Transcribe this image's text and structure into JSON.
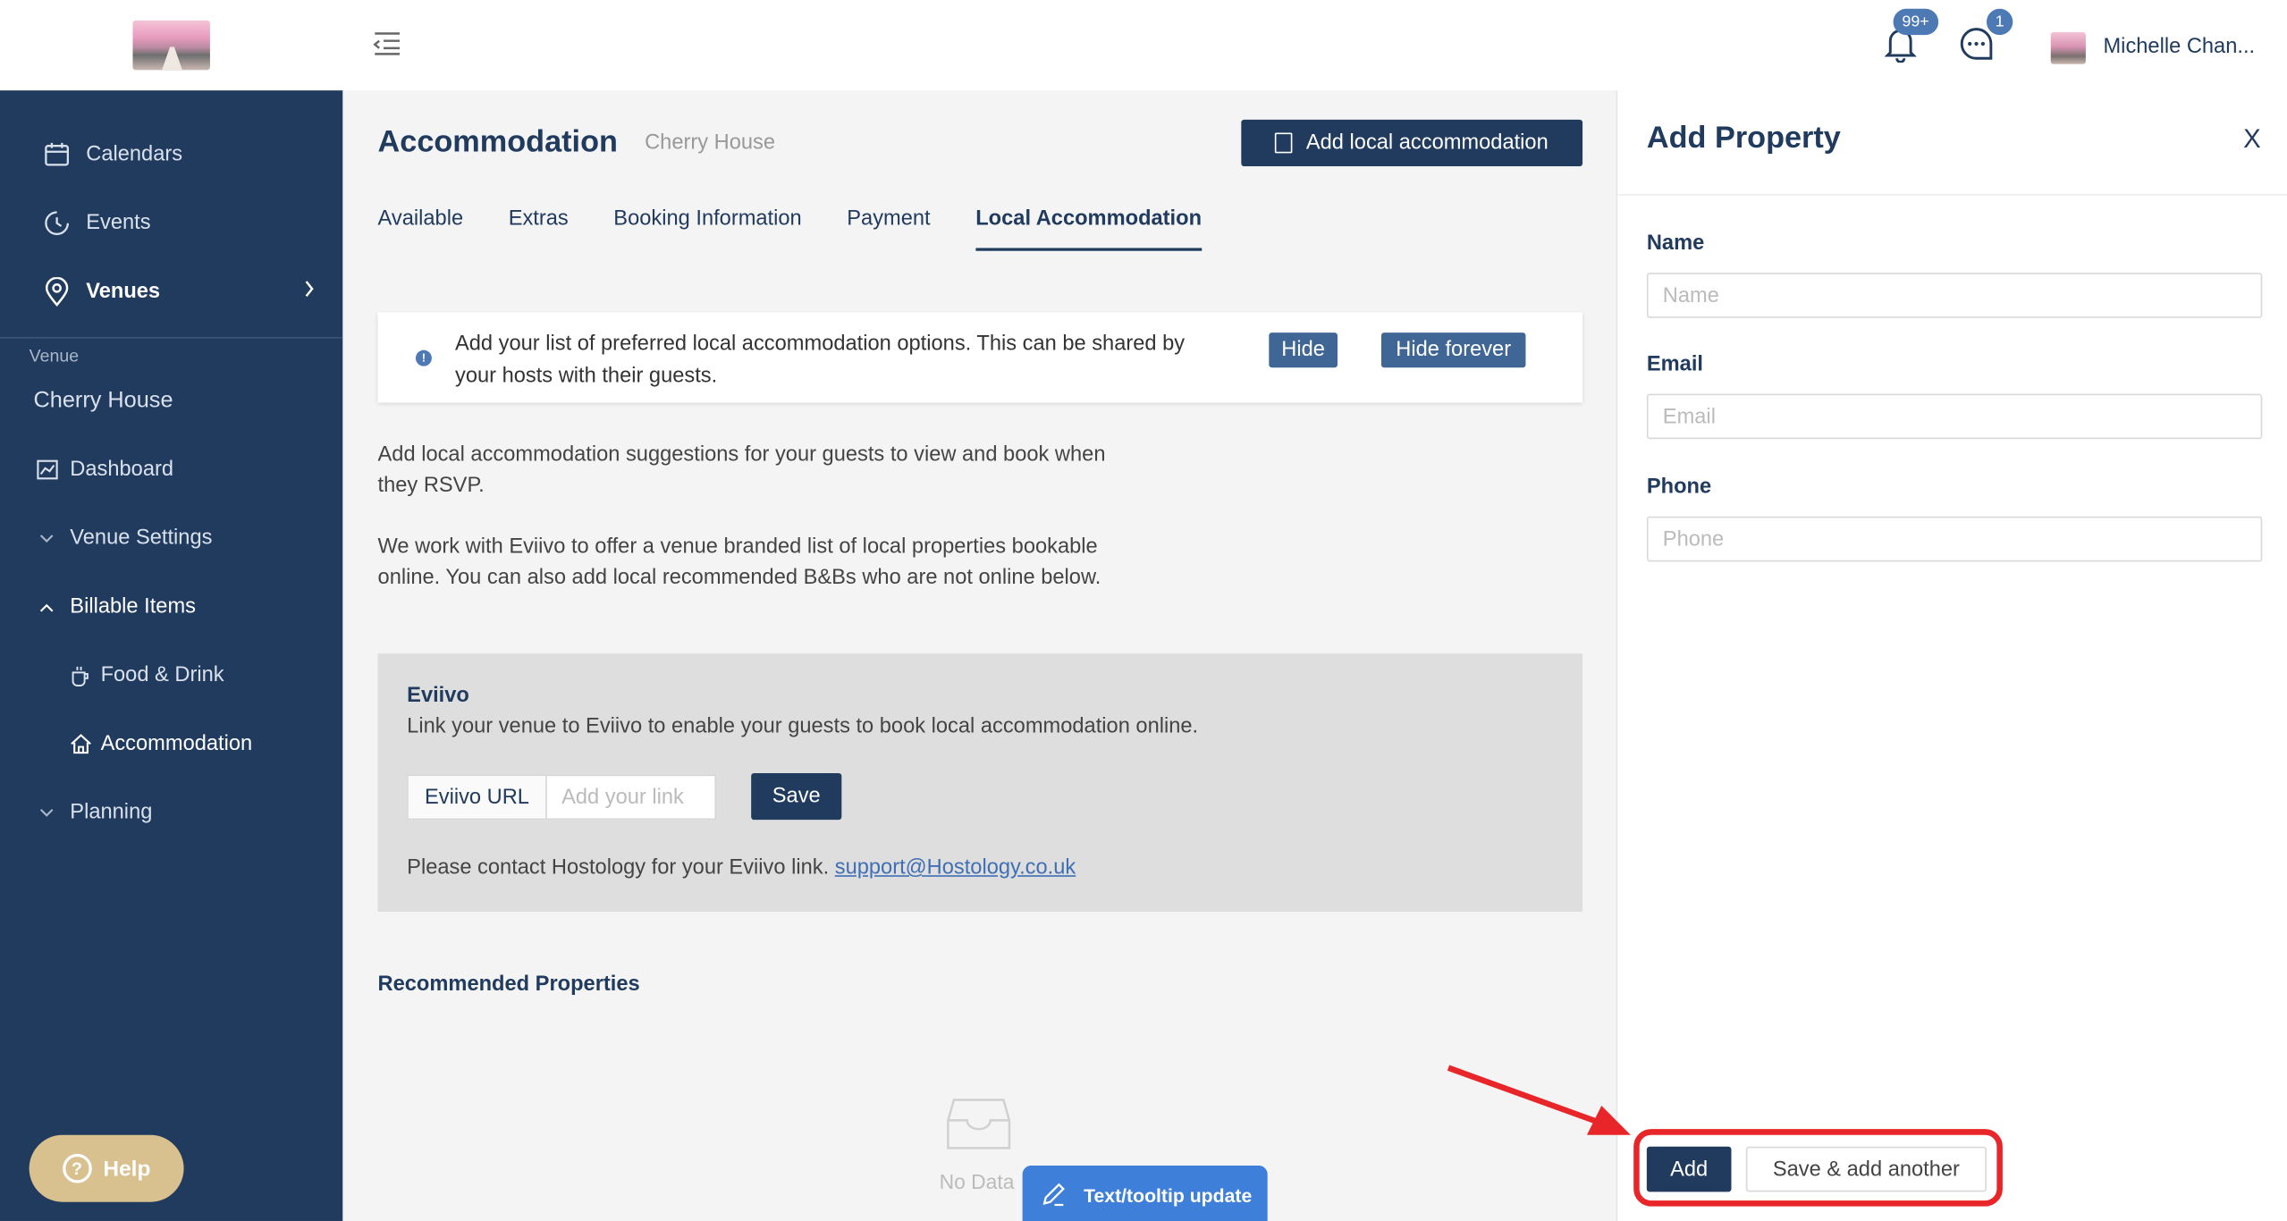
{
  "header": {
    "notifications_badge": "99+",
    "messages_badge": "1",
    "user_name": "Michelle Chan..."
  },
  "sidebar": {
    "top_items": [
      {
        "label": "Calendars",
        "icon": "calendar-icon"
      },
      {
        "label": "Events",
        "icon": "clock-icon"
      },
      {
        "label": "Venues",
        "icon": "location-pin-icon"
      }
    ],
    "section_label": "Venue",
    "venue_name": "Cherry House",
    "items": [
      {
        "label": "Dashboard",
        "icon": "chart-icon"
      },
      {
        "label": "Venue Settings",
        "icon": "chevron-down-icon"
      },
      {
        "label": "Billable Items",
        "icon": "chevron-up-icon"
      },
      {
        "label": "Food & Drink",
        "icon": "coffee-cup-icon"
      },
      {
        "label": "Accommodation",
        "icon": "home-icon"
      },
      {
        "label": "Planning",
        "icon": "chevron-down-icon"
      }
    ],
    "help_label": "Help"
  },
  "main": {
    "title": "Accommodation",
    "subtitle": "Cherry House",
    "add_button": "Add local accommodation",
    "tabs": [
      {
        "label": "Available"
      },
      {
        "label": "Extras"
      },
      {
        "label": "Booking Information"
      },
      {
        "label": "Payment"
      },
      {
        "label": "Local Accommodation"
      }
    ],
    "active_tab": "Local Accommodation",
    "notice": {
      "text": "Add your list of preferred local accommodation options. This can be shared by your hosts with their guests.",
      "hide": "Hide",
      "hide_forever": "Hide forever"
    },
    "para1": "Add local accommodation suggestions for your guests to view and book when they RSVP.",
    "para2": "We work with Eviivo to offer a venue branded list of local properties bookable online. You can also add local recommended B&Bs who are not online below.",
    "eviivo": {
      "title": "Eviivo",
      "description": "Link your venue to Eviivo to enable your guests to book local accommodation online.",
      "url_label": "Eviivo URL",
      "url_placeholder": "Add your link",
      "save": "Save",
      "contact_text": "Please contact Hostology for your Eviivo link.",
      "contact_email": "support@Hostology.co.uk"
    },
    "recommended_title": "Recommended Properties",
    "no_data": "No Data",
    "tooltip_update": "Text/tooltip update"
  },
  "panel": {
    "title": "Add Property",
    "close": "X",
    "fields": [
      {
        "label": "Name",
        "placeholder": "Name"
      },
      {
        "label": "Email",
        "placeholder": "Email"
      },
      {
        "label": "Phone",
        "placeholder": "Phone"
      }
    ],
    "add_button": "Add",
    "save_another_button": "Save & add another"
  },
  "colors": {
    "navy": "#213b5f",
    "accent_blue": "#3f6694",
    "help_gold": "#d9c08f",
    "annotation_red": "#e8262a"
  }
}
